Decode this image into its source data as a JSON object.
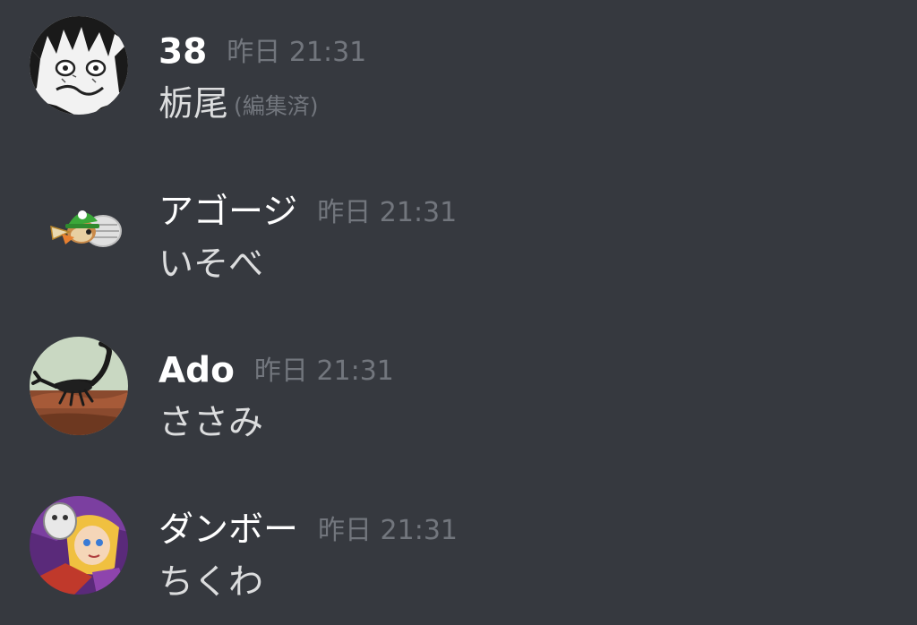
{
  "messages": [
    {
      "author": "38",
      "timestamp": "昨日 21:31",
      "text": "栃尾",
      "edited_label": "(編集済)",
      "avatar_icon": "manga-face-avatar-icon"
    },
    {
      "author": "アゴージ",
      "timestamp": "昨日 21:31",
      "text": "いそべ",
      "avatar_icon": "green-cap-bird-sprite-icon"
    },
    {
      "author": "Ado",
      "timestamp": "昨日 21:31",
      "text": "ささみ",
      "avatar_icon": "scorpion-photo-avatar-icon"
    },
    {
      "author": "ダンボー",
      "timestamp": "昨日 21:31",
      "text": "ちくわ",
      "avatar_icon": "anime-girl-mask-avatar-icon"
    }
  ],
  "colors": {
    "background": "#36393f",
    "username": "#ffffff",
    "timestamp": "#72767d",
    "message_text": "#dcddde"
  }
}
